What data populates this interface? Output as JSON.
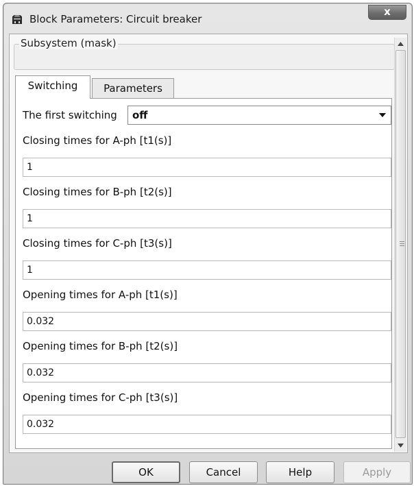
{
  "window": {
    "title": "Block Parameters: Circuit breaker",
    "close_label": "x"
  },
  "mask": {
    "label": "Subsystem (mask)"
  },
  "tabs": [
    {
      "label": "Switching",
      "active": true
    },
    {
      "label": "Parameters",
      "active": false
    }
  ],
  "switching": {
    "first_switching_label": "The first switching",
    "first_switching_value": "off",
    "fields": [
      {
        "label": "Closing times for A-ph [t1(s)]",
        "value": "1"
      },
      {
        "label": "Closing times for B-ph  [t2(s)]",
        "value": "1"
      },
      {
        "label": "Closing times for C-ph  [t3(s)]",
        "value": "1"
      },
      {
        "label": "Opening times for A-ph [t1(s)]",
        "value": "0.032"
      },
      {
        "label": "Opening times for B-ph [t2(s)]",
        "value": "0.032"
      },
      {
        "label": "Opening times for C-ph [t3(s)]",
        "value": "0.032"
      }
    ]
  },
  "buttons": {
    "ok": "OK",
    "cancel": "Cancel",
    "help": "Help",
    "apply": "Apply"
  },
  "icons": {
    "app": "simulink-block-icon",
    "dropdown": "chevron-down-icon",
    "scroll_up": "arrow-up-icon",
    "scroll_down": "arrow-down-icon"
  }
}
